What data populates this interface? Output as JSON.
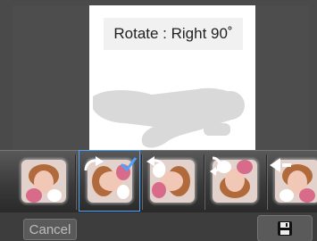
{
  "header": {
    "rotate_label": "Rotate : Right 90˚"
  },
  "toolbar": {
    "cancel_label": "Cancel"
  },
  "thumbnails": [
    {
      "option": "original",
      "icon": "none"
    },
    {
      "option": "rotate-right-90",
      "icon": "rotate-right-icon",
      "selected": true
    },
    {
      "option": "rotate-left-90",
      "icon": "rotate-left-icon"
    },
    {
      "option": "rotate-180",
      "icon": "rotate-180-icon"
    },
    {
      "option": "flip-horizontal",
      "icon": "flip-horizontal-icon"
    }
  ],
  "colors": {
    "selection": "#4da3ff",
    "background": "#4a4a4a"
  }
}
